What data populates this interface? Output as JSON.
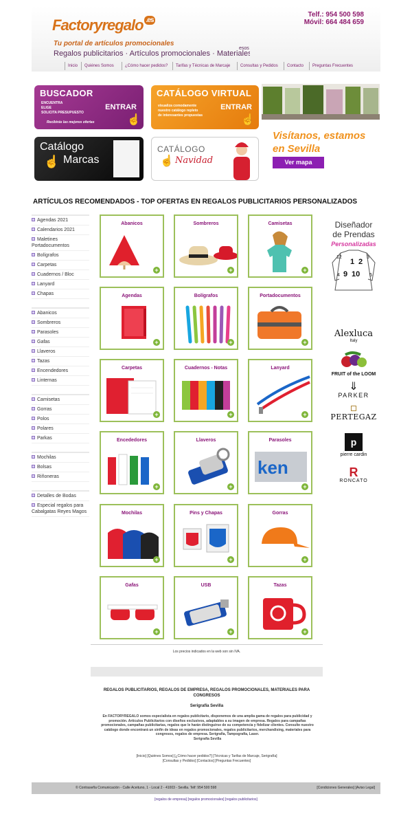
{
  "header": {
    "logo_main": "Factory",
    "logo_accent": "regalo",
    "logo_tld": ".es",
    "tagline": "Tu portal de artículos promocionales",
    "subline": "Regalos publicitarios · Artículos promocionales · Materiales para congr",
    "subline_extra": "esos",
    "phone": "Telf.: 954 500 598",
    "mobile": "Móvil: 664 484 659"
  },
  "nav": [
    "Inicio",
    "Quiénes Somos",
    "¿Cómo hacer pedidos?",
    "Tarifas y Técnicas de Marcaje",
    "Consultas y Pedidos",
    "Contacto",
    "Preguntas Frecuentes"
  ],
  "banners": {
    "buscador": {
      "title": "BUSCADOR",
      "lines": [
        "ENCUENTRA",
        "ELIGE",
        "SOLICITA PRESUPUESTO"
      ],
      "enter": "ENTRAR",
      "bottom": "Recibirás las mejores ofertas"
    },
    "catalogo": {
      "title": "CATÁLOGO VIRTUAL",
      "lines": [
        "visualiza comodamente",
        "nuestro catálogo repleto",
        "de interesantes propuestas"
      ],
      "enter": "ENTRAR"
    },
    "marcas": {
      "line1": "Catálogo",
      "line2": "Marcas"
    },
    "navidad": {
      "line1": "CATÁLOGO",
      "line2": "Navidad"
    },
    "visit": "Visítanos, estamos en Sevilla",
    "map_button": "Ver mapa"
  },
  "section_heading": "ARTÍCULOS RECOMENDADOS - TOP OFERTAS EN REGALOS PUBLICITARIOS PERSONALIZADOS",
  "sidebar": [
    [
      "Agendas 2021",
      "Calendarios 2021",
      "Maletines Portadocumentos",
      "Bolígrafos",
      "Carpetas",
      "Cuadernos / Bloc",
      "Lanyard",
      "Chapas"
    ],
    [
      "Abanicos",
      "Sombreros",
      "Parasoles",
      "Gafas",
      "Llaveros",
      "Tazas",
      "Encendedores",
      "Linternas"
    ],
    [
      "Camisetas",
      "Gorras",
      "Polos",
      "Polares",
      "Parkas"
    ],
    [
      "Mochilas",
      "Bolsas",
      "Riñoneras"
    ],
    [
      "Detalles de Bodas",
      "Especial regalos para Cabalgatas Reyes Magos"
    ]
  ],
  "products": [
    "Abanicos",
    "Sombreros",
    "Camisetas",
    "Agendas",
    "Bolígrafos",
    "Portadocumentos",
    "Carpetas",
    "Cuadernos - Notas",
    "Lanyard",
    "Encededores",
    "Llaveros",
    "Parasoles",
    "Mochilas",
    "Pins y Chapas",
    "Gorras",
    "Gafas",
    "USB",
    "Tazas"
  ],
  "plus_symbol": "+",
  "designer": {
    "line1": "Diseñador",
    "line2": "de Prendas",
    "line3": "Personalizadas",
    "sizes": [
      "12",
      "1",
      "3",
      "4",
      "9",
      "10",
      "5",
      "2"
    ]
  },
  "brands": {
    "alexluca": "Alexluca",
    "alexluca_sub": "Italy",
    "fruit": "FRUIT of the LOOM",
    "parker": "PARKER",
    "pertegaz": "PERTEGAZ",
    "pierre": "pierre cardin",
    "roncato": "RONCATO"
  },
  "footer": {
    "iva": "Los precios indicados en la web son sin IVA.",
    "title": "REGALOS PUBLICITARIOS, REGALOS DE EMPRESA, REGALOS PROMOCIONALES, MATERIALES PARA CONGRESOS",
    "serigrafia": "Serigrafía Sevilla",
    "description": "En FACTORYREGALO somos especialista en regalos publicitario, disponemos de una amplia gama de regalos para publicidad y promoción. Artículos Publicitarios con diseños exclusivos, adaptables a su imagen de empresa. Regalos para campañas promocionales, campañas publicitarias, regalos que le harán distinguirse de su competencia y fidelizar clientes. Consulte nuestro catálogo donde encontrará un sinfín de ideas en regalos promocionales, regalos publicitarios, merchandising, materiales para congresos, regalos de empresa. Serigrafía, Tampografía, Laser.",
    "description_end": "Serigrafía Sevilla",
    "links1": "[Inicio] [Quiénes Somos] [¿Cómo hacer pedidos?] [Técnicas y Tarifas de Marcaje, Serigrafía]",
    "links2": "[Consultas y Pedidos] [Contactos] [Preguntas Frecuentes]",
    "copyright": "© Contraseña Comunicación - Calle Aceituno, 1 - Local 2 - 41003 - Sevilla. Telf: 954 500 598",
    "legal": "[Condiciones Generales] [Aviso Legal]",
    "bottom_links": "[regalos de empresa] [regalos promocionales] [regalos publicitarios]"
  },
  "colors": {
    "purple": "#8a1478",
    "orange": "#e57b0c",
    "green": "#9cc05a"
  }
}
